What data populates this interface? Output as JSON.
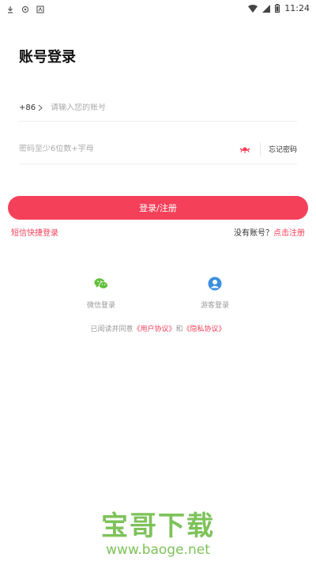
{
  "status_bar": {
    "time": "11:24",
    "icons": [
      "download-icon",
      "sync-icon",
      "app-icon",
      "wifi-icon",
      "signal-icon",
      "battery-icon"
    ]
  },
  "page": {
    "title": "账号登录"
  },
  "phone": {
    "country_code": "+86",
    "placeholder": "请输入您的账号"
  },
  "password": {
    "placeholder": "密码至少6位数+字母",
    "forgot_label": "忘记密码"
  },
  "actions": {
    "login_label": "登录/注册",
    "sms_login_label": "短信快捷登录",
    "no_account_label": "没有账号？",
    "register_label": "点击注册"
  },
  "social": {
    "wechat_label": "微信登录",
    "guest_label": "游客登录"
  },
  "agreement": {
    "prefix": "已阅读并同意",
    "user_agreement": "《用户协议》",
    "and": "和",
    "privacy_policy": "《隐私协议》"
  },
  "watermark": {
    "title": "宝哥下载",
    "url": "www.baoge.net"
  },
  "colors": {
    "accent": "#f5405a",
    "wechat": "#5fbf3a",
    "guest": "#3b8fe0",
    "watermark": "#7ec25a"
  }
}
